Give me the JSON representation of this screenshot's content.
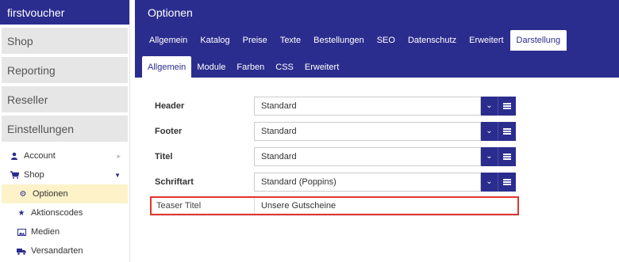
{
  "sidebar": {
    "brand": "firstvoucher",
    "sections": [
      "Shop",
      "Reporting",
      "Reseller",
      "Einstellungen"
    ],
    "items": [
      {
        "label": "Account",
        "icon": "user-icon"
      },
      {
        "label": "Shop",
        "icon": "cart-icon"
      },
      {
        "label": "Optionen",
        "icon": "gear-icon"
      },
      {
        "label": "Aktionscodes",
        "icon": "star-icon"
      },
      {
        "label": "Medien",
        "icon": "image-icon"
      },
      {
        "label": "Versandarten",
        "icon": "truck-icon"
      }
    ]
  },
  "header": {
    "title": "Optionen",
    "tabs": [
      "Allgemein",
      "Katalog",
      "Preise",
      "Texte",
      "Bestellungen",
      "SEO",
      "Datenschutz",
      "Erweitert",
      "Darstellung"
    ],
    "active_tab": "Darstellung",
    "subtabs": [
      "Allgemein",
      "Module",
      "Farben",
      "CSS",
      "Erweitert"
    ],
    "active_subtab": "Allgemein"
  },
  "form": {
    "fields": [
      {
        "label": "Header",
        "value": "Standard"
      },
      {
        "label": "Footer",
        "value": "Standard"
      },
      {
        "label": "Titel",
        "value": "Standard"
      },
      {
        "label": "Schriftart",
        "value": "Standard (Poppins)"
      }
    ],
    "teaser": {
      "label": "Teaser Titel",
      "value": "Unsere Gutscheine"
    }
  },
  "colors": {
    "primary": "#2b2d8e",
    "highlight": "#e3342f",
    "active_row": "#fdf2c8"
  }
}
